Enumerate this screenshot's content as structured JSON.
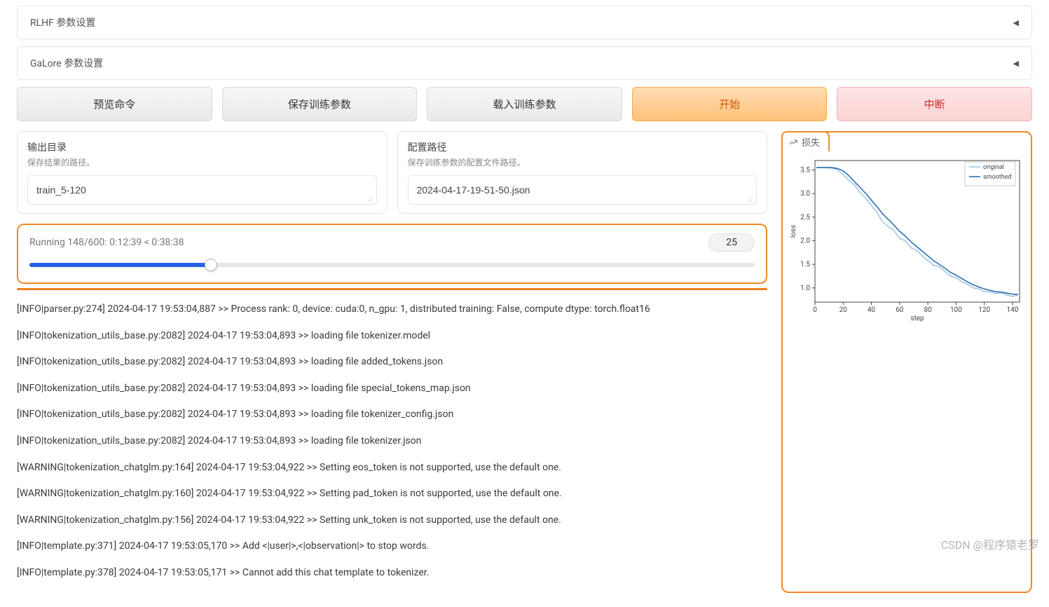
{
  "accordions": {
    "rlhf": "RLHF 参数设置",
    "galore": "GaLore 参数设置"
  },
  "buttons": {
    "preview": "预览命令",
    "save": "保存训练参数",
    "load": "载入训练参数",
    "start": "开始",
    "stop": "中断"
  },
  "output_field": {
    "label": "输出目录",
    "desc": "保存结果的路径。",
    "value": "train_5-120"
  },
  "config_field": {
    "label": "配置路径",
    "desc": "保存训练参数的配置文件路径。",
    "value": "2024-04-17-19-51-50.json"
  },
  "progress": {
    "status": "Running 148/600: 0:12:39 < 0:38:38",
    "value": "25",
    "percent": 25
  },
  "logs": [
    "[INFO|parser.py:274] 2024-04-17 19:53:04,887 >> Process rank: 0, device: cuda:0, n_gpu: 1, distributed training: False, compute dtype: torch.float16",
    "[INFO|tokenization_utils_base.py:2082] 2024-04-17 19:53:04,893 >> loading file tokenizer.model",
    "[INFO|tokenization_utils_base.py:2082] 2024-04-17 19:53:04,893 >> loading file added_tokens.json",
    "[INFO|tokenization_utils_base.py:2082] 2024-04-17 19:53:04,893 >> loading file special_tokens_map.json",
    "[INFO|tokenization_utils_base.py:2082] 2024-04-17 19:53:04,893 >> loading file tokenizer_config.json",
    "[INFO|tokenization_utils_base.py:2082] 2024-04-17 19:53:04,893 >> loading file tokenizer.json",
    "[WARNING|tokenization_chatglm.py:164] 2024-04-17 19:53:04,922 >> Setting eos_token is not supported, use the default one.",
    "[WARNING|tokenization_chatglm.py:160] 2024-04-17 19:53:04,922 >> Setting pad_token is not supported, use the default one.",
    "[WARNING|tokenization_chatglm.py:156] 2024-04-17 19:53:04,922 >> Setting unk_token is not supported, use the default one.",
    "[INFO|template.py:371] 2024-04-17 19:53:05,170 >> Add <|user|>,<|observation|> to stop words.",
    "[INFO|template.py:378] 2024-04-17 19:53:05,171 >> Cannot add this chat template to tokenizer."
  ],
  "chart_tab": "损失",
  "chart_data": {
    "type": "line",
    "title": "",
    "xlabel": "step",
    "ylabel": "loss",
    "xlim": [
      0,
      145
    ],
    "ylim": [
      0.7,
      3.7
    ],
    "xticks": [
      0,
      20,
      40,
      60,
      80,
      100,
      120,
      140
    ],
    "yticks": [
      1.0,
      1.5,
      2.0,
      2.5,
      3.0,
      3.5
    ],
    "series": [
      {
        "name": "original",
        "color": "#9fc7e6",
        "values": [
          [
            1,
            3.55
          ],
          [
            4,
            3.55
          ],
          [
            8,
            3.55
          ],
          [
            12,
            3.54
          ],
          [
            16,
            3.5
          ],
          [
            20,
            3.4
          ],
          [
            24,
            3.28
          ],
          [
            28,
            3.18
          ],
          [
            32,
            3.02
          ],
          [
            36,
            2.9
          ],
          [
            40,
            2.75
          ],
          [
            44,
            2.6
          ],
          [
            48,
            2.4
          ],
          [
            52,
            2.3
          ],
          [
            56,
            2.22
          ],
          [
            60,
            2.05
          ],
          [
            64,
            2.0
          ],
          [
            68,
            1.85
          ],
          [
            72,
            1.8
          ],
          [
            76,
            1.68
          ],
          [
            80,
            1.58
          ],
          [
            84,
            1.48
          ],
          [
            88,
            1.45
          ],
          [
            92,
            1.35
          ],
          [
            96,
            1.25
          ],
          [
            100,
            1.22
          ],
          [
            104,
            1.13
          ],
          [
            108,
            1.08
          ],
          [
            112,
            1.0
          ],
          [
            116,
            0.98
          ],
          [
            120,
            0.92
          ],
          [
            124,
            0.92
          ],
          [
            128,
            0.88
          ],
          [
            132,
            0.9
          ],
          [
            136,
            0.85
          ],
          [
            140,
            0.82
          ],
          [
            144,
            0.85
          ]
        ]
      },
      {
        "name": "smoothed",
        "color": "#2f6fb3",
        "values": [
          [
            1,
            3.55
          ],
          [
            4,
            3.55
          ],
          [
            8,
            3.55
          ],
          [
            12,
            3.55
          ],
          [
            16,
            3.53
          ],
          [
            20,
            3.48
          ],
          [
            24,
            3.38
          ],
          [
            28,
            3.25
          ],
          [
            32,
            3.13
          ],
          [
            36,
            3.0
          ],
          [
            40,
            2.86
          ],
          [
            44,
            2.72
          ],
          [
            48,
            2.57
          ],
          [
            52,
            2.45
          ],
          [
            56,
            2.33
          ],
          [
            60,
            2.2
          ],
          [
            64,
            2.1
          ],
          [
            68,
            1.98
          ],
          [
            72,
            1.88
          ],
          [
            76,
            1.78
          ],
          [
            80,
            1.68
          ],
          [
            84,
            1.58
          ],
          [
            88,
            1.5
          ],
          [
            92,
            1.42
          ],
          [
            96,
            1.33
          ],
          [
            100,
            1.27
          ],
          [
            104,
            1.2
          ],
          [
            108,
            1.13
          ],
          [
            112,
            1.07
          ],
          [
            116,
            1.02
          ],
          [
            120,
            0.98
          ],
          [
            124,
            0.95
          ],
          [
            128,
            0.92
          ],
          [
            132,
            0.91
          ],
          [
            136,
            0.89
          ],
          [
            140,
            0.87
          ],
          [
            144,
            0.86
          ]
        ]
      }
    ]
  },
  "watermark": "CSDN @程序猿老罗"
}
